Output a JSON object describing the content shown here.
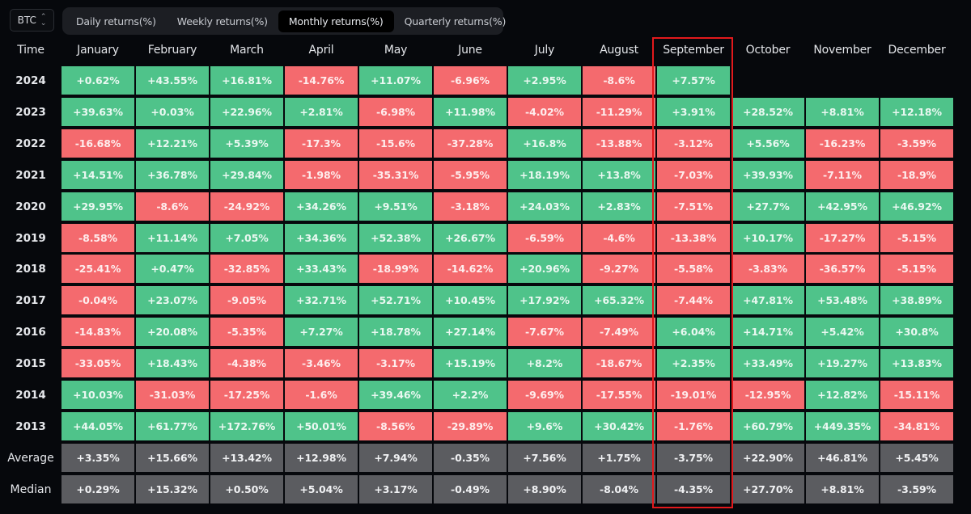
{
  "asset_select": {
    "value": "BTC",
    "icon": "updown-chevron-icon"
  },
  "tabs": [
    {
      "label": "Daily returns(%)",
      "active": false
    },
    {
      "label": "Weekly returns(%)",
      "active": false
    },
    {
      "label": "Monthly returns(%)",
      "active": true
    },
    {
      "label": "Quarterly returns(%)",
      "active": false
    }
  ],
  "highlighted_column": "September",
  "colors": {
    "positive": "#4fc38a",
    "negative": "#f46a6e",
    "summary": "#5b5c60",
    "highlight": "#e2191c"
  },
  "chart_data": {
    "type": "heatmap",
    "title": "BTC Monthly returns(%)",
    "x_header": "Time",
    "columns": [
      "January",
      "February",
      "March",
      "April",
      "May",
      "June",
      "July",
      "August",
      "September",
      "October",
      "November",
      "December"
    ],
    "rows": [
      {
        "label": "2024",
        "values": [
          "+0.62%",
          "+43.55%",
          "+16.81%",
          "-14.76%",
          "+11.07%",
          "-6.96%",
          "+2.95%",
          "-8.6%",
          "+7.57%",
          "",
          "",
          ""
        ]
      },
      {
        "label": "2023",
        "values": [
          "+39.63%",
          "+0.03%",
          "+22.96%",
          "+2.81%",
          "-6.98%",
          "+11.98%",
          "-4.02%",
          "-11.29%",
          "+3.91%",
          "+28.52%",
          "+8.81%",
          "+12.18%"
        ]
      },
      {
        "label": "2022",
        "values": [
          "-16.68%",
          "+12.21%",
          "+5.39%",
          "-17.3%",
          "-15.6%",
          "-37.28%",
          "+16.8%",
          "-13.88%",
          "-3.12%",
          "+5.56%",
          "-16.23%",
          "-3.59%"
        ]
      },
      {
        "label": "2021",
        "values": [
          "+14.51%",
          "+36.78%",
          "+29.84%",
          "-1.98%",
          "-35.31%",
          "-5.95%",
          "+18.19%",
          "+13.8%",
          "-7.03%",
          "+39.93%",
          "-7.11%",
          "-18.9%"
        ]
      },
      {
        "label": "2020",
        "values": [
          "+29.95%",
          "-8.6%",
          "-24.92%",
          "+34.26%",
          "+9.51%",
          "-3.18%",
          "+24.03%",
          "+2.83%",
          "-7.51%",
          "+27.7%",
          "+42.95%",
          "+46.92%"
        ]
      },
      {
        "label": "2019",
        "values": [
          "-8.58%",
          "+11.14%",
          "+7.05%",
          "+34.36%",
          "+52.38%",
          "+26.67%",
          "-6.59%",
          "-4.6%",
          "-13.38%",
          "+10.17%",
          "-17.27%",
          "-5.15%"
        ]
      },
      {
        "label": "2018",
        "values": [
          "-25.41%",
          "+0.47%",
          "-32.85%",
          "+33.43%",
          "-18.99%",
          "-14.62%",
          "+20.96%",
          "-9.27%",
          "-5.58%",
          "-3.83%",
          "-36.57%",
          "-5.15%"
        ]
      },
      {
        "label": "2017",
        "values": [
          "-0.04%",
          "+23.07%",
          "-9.05%",
          "+32.71%",
          "+52.71%",
          "+10.45%",
          "+17.92%",
          "+65.32%",
          "-7.44%",
          "+47.81%",
          "+53.48%",
          "+38.89%"
        ]
      },
      {
        "label": "2016",
        "values": [
          "-14.83%",
          "+20.08%",
          "-5.35%",
          "+7.27%",
          "+18.78%",
          "+27.14%",
          "-7.67%",
          "-7.49%",
          "+6.04%",
          "+14.71%",
          "+5.42%",
          "+30.8%"
        ]
      },
      {
        "label": "2015",
        "values": [
          "-33.05%",
          "+18.43%",
          "-4.38%",
          "-3.46%",
          "-3.17%",
          "+15.19%",
          "+8.2%",
          "-18.67%",
          "+2.35%",
          "+33.49%",
          "+19.27%",
          "+13.83%"
        ]
      },
      {
        "label": "2014",
        "values": [
          "+10.03%",
          "-31.03%",
          "-17.25%",
          "-1.6%",
          "+39.46%",
          "+2.2%",
          "-9.69%",
          "-17.55%",
          "-19.01%",
          "-12.95%",
          "+12.82%",
          "-15.11%"
        ]
      },
      {
        "label": "2013",
        "values": [
          "+44.05%",
          "+61.77%",
          "+172.76%",
          "+50.01%",
          "-8.56%",
          "-29.89%",
          "+9.6%",
          "+30.42%",
          "-1.76%",
          "+60.79%",
          "+449.35%",
          "-34.81%"
        ]
      }
    ],
    "summary_rows": [
      {
        "label": "Average",
        "values": [
          "+3.35%",
          "+15.66%",
          "+13.42%",
          "+12.98%",
          "+7.94%",
          "-0.35%",
          "+7.56%",
          "+1.75%",
          "-3.75%",
          "+22.90%",
          "+46.81%",
          "+5.45%"
        ]
      },
      {
        "label": "Median",
        "values": [
          "+0.29%",
          "+15.32%",
          "+0.50%",
          "+5.04%",
          "+3.17%",
          "-0.49%",
          "+8.90%",
          "-8.04%",
          "-4.35%",
          "+27.70%",
          "+8.81%",
          "-3.59%"
        ]
      }
    ]
  }
}
